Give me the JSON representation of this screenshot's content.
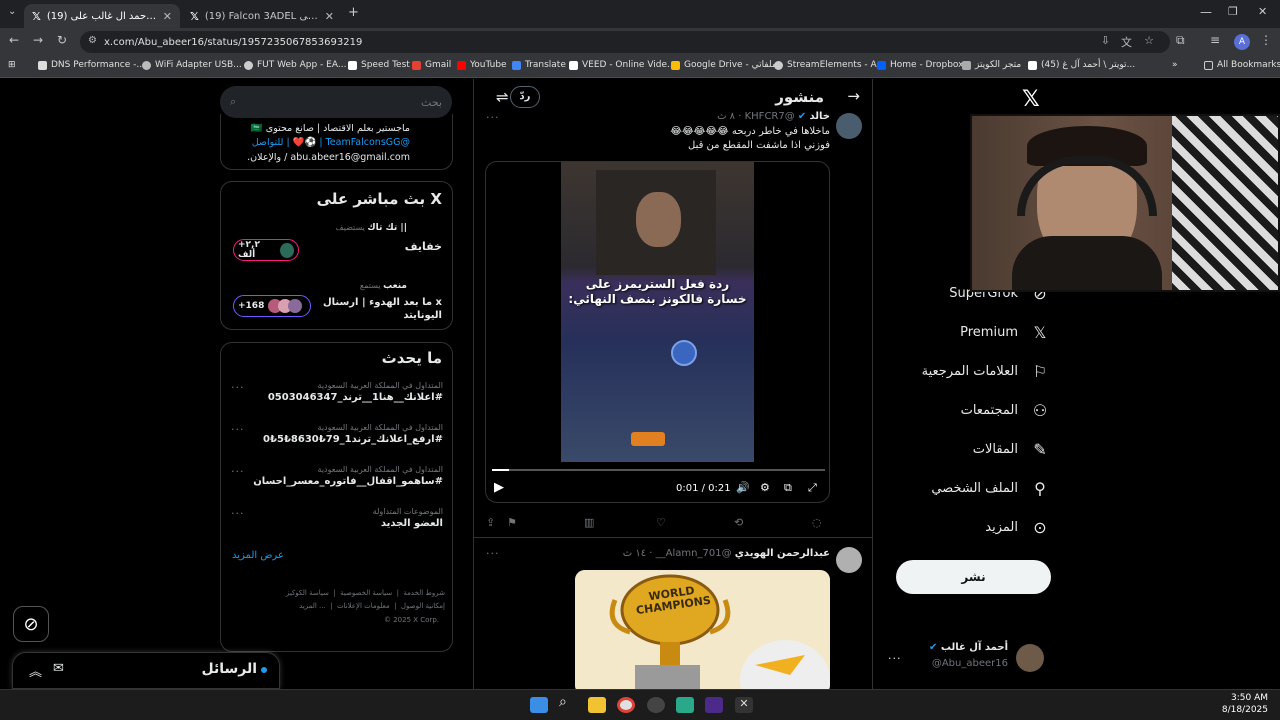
{
  "browser": {
    "tabs": [
      {
        "label": "(19) أحمد آل غالب على X: \"مشاركة..."
      },
      {
        "label": "(19) Falcon 3ADEL على X: \"مكة..."
      }
    ],
    "url": "x.com/Abu_abeer16/status/1957235067853693219",
    "bookmarks": [
      "DNS Performance -...",
      "WiFi Adapter USB...",
      "FUT Web App - EA...",
      "Speed Test",
      "Gmail",
      "YouTube",
      "Translate",
      "VEED - Online Vide...",
      "Google Drive - ملفاتي",
      "StreamElements - A...",
      "Home - Dropbox",
      "متجر الكويتز",
      "(45) تويتر \\ أحمد آل غ..."
    ],
    "all_bookmarks": "All Bookmarks",
    "avatar_letter": "A"
  },
  "sidebar": {
    "search_placeholder": "بحث",
    "bio_lines": [
      "ماجستير بعلم الاقتصاد | صانع محتوى 🇸🇦",
      "@TeamFalconsGG | ⚽️❤️ | للتواصل",
      "abu.abeer16@gmail.com / والإعلان."
    ],
    "live": {
      "title": "X بث مباشر على",
      "items": [
        {
          "context": "يستضيف",
          "host": "|| تك تاك",
          "title": "خفايف",
          "count": "+٢,٢ ألف"
        },
        {
          "context": "يستمع",
          "host": "منعب",
          "title": "x ما بعد الهدوء | ارسنال اليونايتد",
          "count": "+168"
        }
      ]
    },
    "trends": {
      "title": "ما يحدث",
      "items": [
        {
          "category": "المتداول في المملكة العربية السعودية",
          "name": "#اعلانك__هنا1__ترند_0503046347"
        },
        {
          "category": "المتداول في المملكة العربية السعودية",
          "name": "#ارفع_اعلانك_ترند1_79₺8630₺5₺0"
        },
        {
          "category": "المتداول في المملكة العربية السعودية",
          "name": "#ساهمو_اقفال__فاتوره_معسر_احسان"
        },
        {
          "category": "الموضوعات المتداولة",
          "name": "العضو الجديد"
        }
      ],
      "more": "عرض المزيد"
    },
    "footer": {
      "line1": [
        "شروط الخدمة",
        "سياسة الخصوصية",
        "سياسة الكوكيز"
      ],
      "line2": [
        "إمكانية الوصول",
        "معلومات الإعلانات",
        "... المزيد"
      ],
      "copyright": "© 2025 X Corp."
    },
    "messages": "الرسائل"
  },
  "feed": {
    "header_title": "منشور",
    "reply_label": "ردّ",
    "tweet1": {
      "name": "خالد",
      "handle": "@KHFCR7",
      "time": "٨ ث",
      "line1": "ماخلاها في خاطر دربحه 😂😂😂😂😂",
      "line2": "فوزني اذا ماشفت المقطع من قبل",
      "video_caption": "ردة فعل الستريمرز على خسارة فالكونز بنصف النهائي:",
      "video_time": "0:01 / 0:21",
      "video_progress": 0.05
    },
    "tweet2": {
      "name": "عبدالرحمن الهويدي",
      "handle": "@Alamn_701__",
      "time": "١٤ ث",
      "image_text": "WORLD CHAMPIONS"
    }
  },
  "nav": {
    "items": [
      "SuperGrok",
      "Premium",
      "العلامات المرجعية",
      "المجتمعات",
      "المقالات",
      "الملف الشخصي",
      "المزيد"
    ],
    "post_button": "نشر",
    "profile": {
      "name": "أحمد آل غالب",
      "handle": "@Abu_abeer16"
    }
  },
  "taskbar": {
    "time": "3:50 AM",
    "date": "8/18/2025"
  }
}
